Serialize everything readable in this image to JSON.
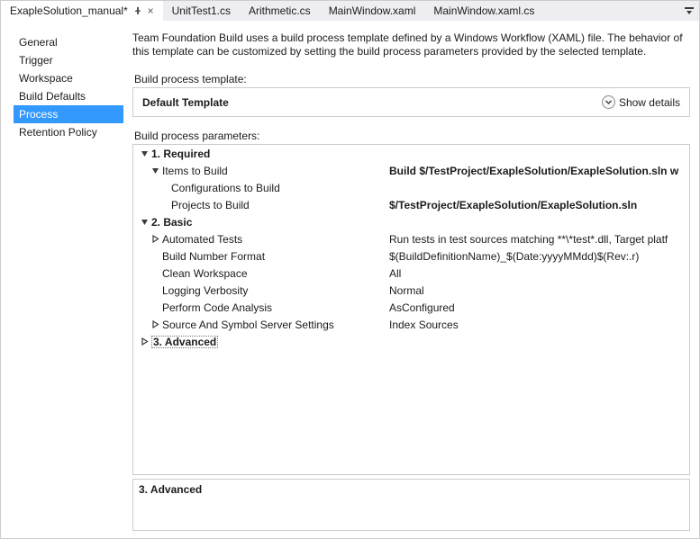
{
  "tabs": [
    {
      "label": "ExapleSolution_manual*",
      "active": true,
      "pinned": true,
      "closable": true
    },
    {
      "label": "UnitTest1.cs",
      "active": false
    },
    {
      "label": "Arithmetic.cs",
      "active": false
    },
    {
      "label": "MainWindow.xaml",
      "active": false
    },
    {
      "label": "MainWindow.xaml.cs",
      "active": false
    }
  ],
  "sidebar": {
    "items": [
      {
        "label": "General"
      },
      {
        "label": "Trigger"
      },
      {
        "label": "Workspace"
      },
      {
        "label": "Build Defaults"
      },
      {
        "label": "Process",
        "selected": true
      },
      {
        "label": "Retention Policy"
      }
    ]
  },
  "intro": "Team Foundation Build uses a build process template defined by a Windows Workflow (XAML) file. The behavior of this template can be customized by setting the build process parameters provided by the selected template.",
  "template": {
    "section_label": "Build process template:",
    "name": "Default Template",
    "show_details_label": "Show details"
  },
  "params": {
    "section_label": "Build process parameters:",
    "cat1_label": "1. Required",
    "items_to_build": {
      "name": "Items to Build",
      "value": "Build $/TestProject/ExapleSolution/ExapleSolution.sln w"
    },
    "configs_to_build": {
      "name": "Configurations to Build",
      "value": ""
    },
    "projects_to_build": {
      "name": "Projects to Build",
      "value": "$/TestProject/ExapleSolution/ExapleSolution.sln"
    },
    "cat2_label": "2. Basic",
    "automated_tests": {
      "name": "Automated Tests",
      "value": "Run tests in test sources matching **\\*test*.dll, Target platf"
    },
    "build_number_format": {
      "name": "Build Number Format",
      "value": "$(BuildDefinitionName)_$(Date:yyyyMMdd)$(Rev:.r)"
    },
    "clean_workspace": {
      "name": "Clean Workspace",
      "value": "All"
    },
    "logging_verbosity": {
      "name": "Logging Verbosity",
      "value": "Normal"
    },
    "perform_code_analysis": {
      "name": "Perform Code Analysis",
      "value": "AsConfigured"
    },
    "source_symbol": {
      "name": "Source And Symbol Server Settings",
      "value": "Index Sources"
    },
    "cat3_label": "3. Advanced"
  },
  "description": {
    "title": "3. Advanced",
    "text": ""
  }
}
